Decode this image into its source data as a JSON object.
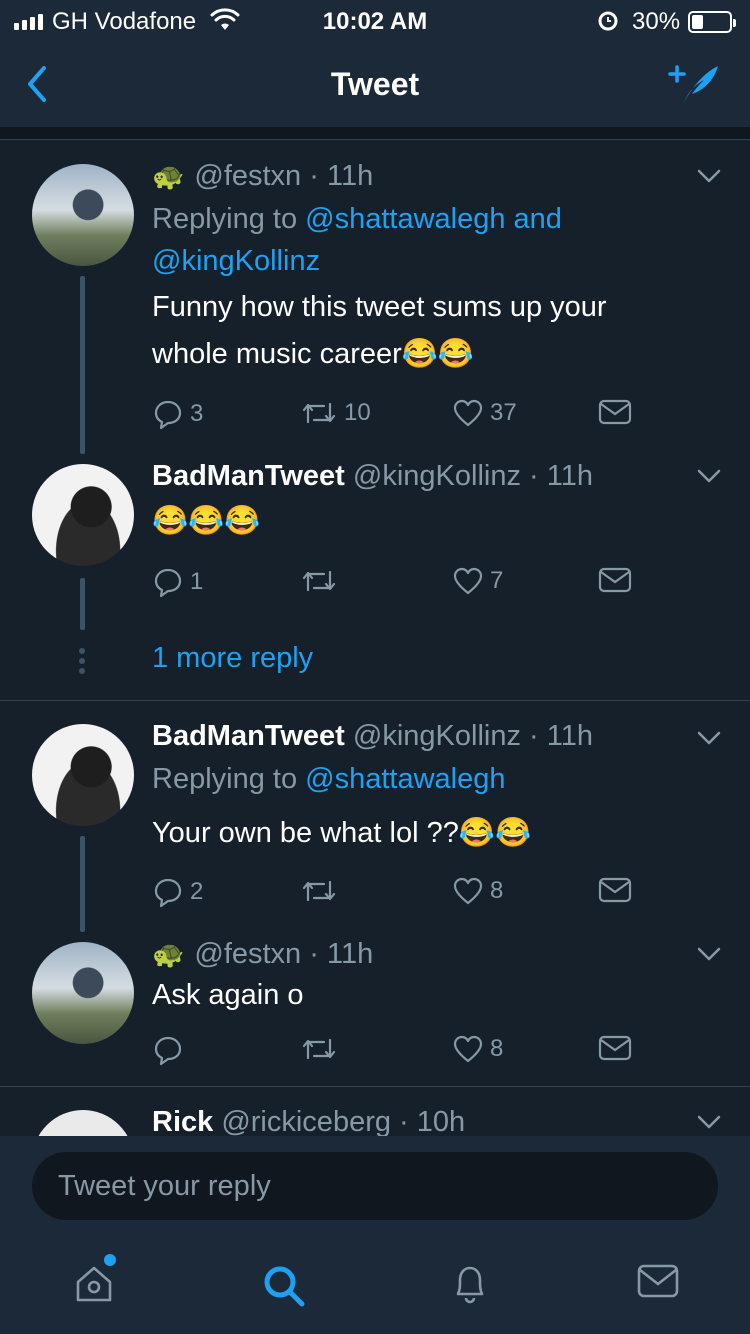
{
  "status_bar": {
    "carrier": "GH Vodafone",
    "time": "10:02 AM",
    "battery_percent": "30%",
    "battery_level": 0.3,
    "icons": [
      "signal-icon",
      "wifi-icon",
      "alarm-icon",
      "battery-icon"
    ]
  },
  "nav": {
    "title": "Tweet",
    "back_icon": "back-chevron-icon",
    "compose_icon": "compose-tweet-icon"
  },
  "tweets": [
    {
      "name": "",
      "handle_emoji": "🐢",
      "handle": "@festxn",
      "time": "· 11h",
      "replying_prefix": "Replying to",
      "replying_links": "@shattawalegh and @kingKollinz",
      "text": "Funny how this tweet sums up your whole music career😂😂",
      "replies": "3",
      "retweets": "10",
      "likes": "37"
    },
    {
      "name": "BadManTweet",
      "handle": "@kingKollinz",
      "time": "· 11h",
      "text": "😂😂😂",
      "replies": "1",
      "retweets": "",
      "likes": "7"
    },
    {
      "more_replies": "1 more reply"
    },
    {
      "name": "BadManTweet",
      "handle": "@kingKollinz",
      "time": "· 11h",
      "replying_prefix": "Replying to",
      "replying_links": "@shattawalegh",
      "text": "Your own be what lol ??😂😂",
      "replies": "2",
      "retweets": "",
      "likes": "8"
    },
    {
      "handle_emoji": "🐢",
      "handle": "@festxn",
      "time": "· 11h",
      "text": "Ask again o",
      "replies": "",
      "retweets": "",
      "likes": "8"
    },
    {
      "name": "Rick",
      "handle": "@rickiceberg",
      "time": "· 10h"
    }
  ],
  "reply_box": {
    "placeholder": "Tweet your reply"
  },
  "tab_bar": {
    "items": [
      "home-icon",
      "search-icon",
      "notifications-icon",
      "messages-icon"
    ],
    "active": "search-icon"
  },
  "colors": {
    "background": "#15202b",
    "bar": "#1c2938",
    "accent": "#1da1f2",
    "secondary_text": "#8899a6",
    "divider": "#38444d"
  }
}
